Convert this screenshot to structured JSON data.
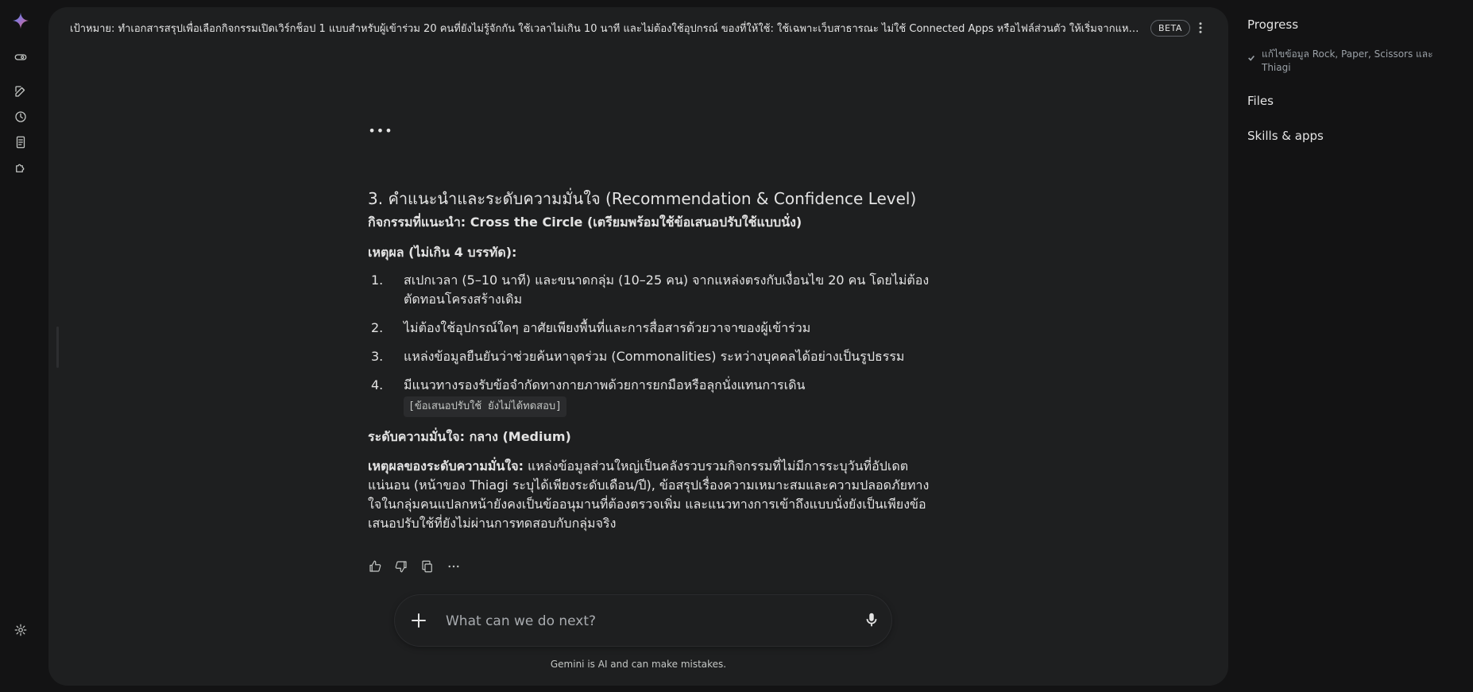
{
  "goal": {
    "text": "เป้าหมาย: ทำเอกสารสรุปเพื่อเลือกกิจกรรมเปิดเวิร์กช็อป 1 แบบสำหรับผู้เข้าร่วม 20 คนที่ยังไม่รู้จักกัน ใช้เวลาไม่เกิน 10 นาที และไม่ต้องใช้อุปกรณ์ ของที่ให้ใช้: ใช้เฉพาะเว็บสาธารณะ ไม่ใช้ Connected Apps หรือไฟล์ส่วนตัว ให้เริ่มจากแหล่งของเจ้าของวิธีหรือคลังกิจ...",
    "badge": "BETA"
  },
  "content": {
    "heading": "3. คำแนะนำและระดับความมั่นใจ (Recommendation & Confidence Level)",
    "recommended": "กิจกรรมที่แนะนำ: Cross the Circle (เตรียมพร้อมใช้ข้อเสนอปรับใช้แบบนั่ง)",
    "reasons_title": "เหตุผล (ไม่เกิน 4 บรรทัด):",
    "reasons": [
      {
        "num": "1.",
        "text": "สเปกเวลา (5–10 นาที) และขนาดกลุ่ม (10–25 คน) จากแหล่งตรงกับเงื่อนไข 20 คน โดยไม่ต้องตัดทอนโครงสร้างเดิม"
      },
      {
        "num": "2.",
        "text": "ไม่ต้องใช้อุปกรณ์ใดๆ อาศัยเพียงพื้นที่และการสื่อสารด้วยวาจาของผู้เข้าร่วม"
      },
      {
        "num": "3.",
        "text": "แหล่งข้อมูลยืนยันว่าช่วยค้นหาจุดร่วม (Commonalities) ระหว่างบุคคลได้อย่างเป็นรูปธรรม"
      },
      {
        "num": "4.",
        "text": "มีแนวทางรองรับข้อจำกัดทางกายภาพด้วยการยกมือหรือลุกนั่งแทนการเดิน",
        "note": "[ข้อเสนอปรับใช้ ยังไม่ได้ทดสอบ]"
      }
    ],
    "confidence": "ระดับความมั่นใจ: กลาง (Medium)",
    "confidence_reason_label": "เหตุผลของระดับความมั่นใจ:",
    "confidence_reason_text": " แหล่งข้อมูลส่วนใหญ่เป็นคลังรวบรวมกิจกรรมที่ไม่มีการระบุวันที่อัปเดตแน่นอน (หน้าของ Thiagi ระบุได้เพียงระดับเดือน/ปี), ข้อสรุปเรื่องความเหมาะสมและความปลอดภัยทางใจในกลุ่มคนแปลกหน้ายังคงเป็นข้ออนุมานที่ต้องตรวจเพิ่ม และแนวทางการเข้าถึงแบบนั่งยังเป็นเพียงข้อเสนอปรับใช้ที่ยังไม่ผ่านการทดสอบกับกลุ่มจริง"
  },
  "composer": {
    "placeholder": "What can we do next?"
  },
  "disclaimer": "Gemini is AI and can make mistakes.",
  "right_panel": {
    "progress_title": "Progress",
    "progress_item": "แก้ไขข้อมูล Rock, Paper, Scissors และ Thiagi",
    "files_title": "Files",
    "skills_title": "Skills & apps"
  },
  "icons": {
    "rail": [
      "gemini-logo-icon",
      "toggle-icon",
      "new-chat-icon",
      "history-icon",
      "notebook-icon",
      "puzzle-icon",
      "settings-icon"
    ],
    "actions": [
      "thumb-up-icon",
      "thumb-down-icon",
      "copy-icon",
      "more-horiz-icon"
    ]
  },
  "colors": {
    "background": "#131314",
    "panel": "#1e1f20",
    "text": "#e3e3e3",
    "muted": "#9aa0a6"
  }
}
